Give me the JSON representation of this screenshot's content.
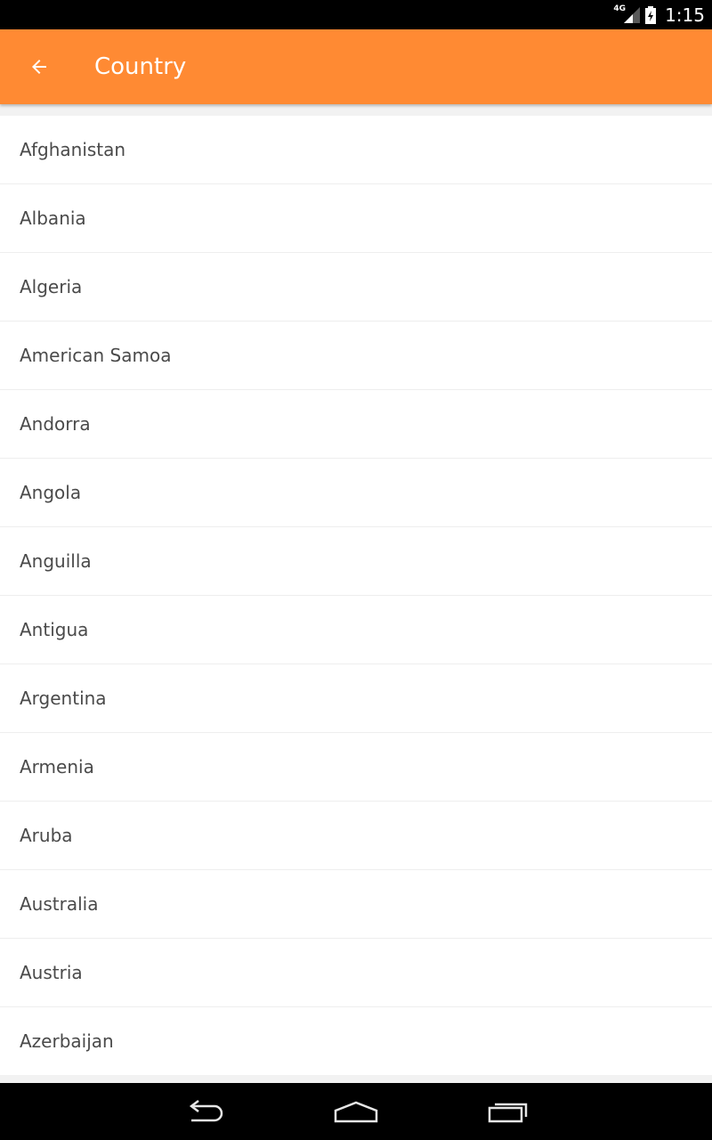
{
  "status_bar": {
    "network": "4G",
    "time": "1:15",
    "icons": [
      "signal-icon",
      "battery-icon"
    ]
  },
  "app_bar": {
    "title": "Country",
    "back_icon": "arrow-back-icon",
    "color": "#ff8a33"
  },
  "countries": [
    "Afghanistan",
    "Albania",
    "Algeria",
    "American Samoa",
    "Andorra",
    "Angola",
    "Anguilla",
    "Antigua",
    "Argentina",
    "Armenia",
    "Aruba",
    "Australia",
    "Austria",
    "Azerbaijan"
  ],
  "nav_bar": {
    "icons": [
      "back-nav-icon",
      "home-nav-icon",
      "recents-nav-icon"
    ]
  }
}
